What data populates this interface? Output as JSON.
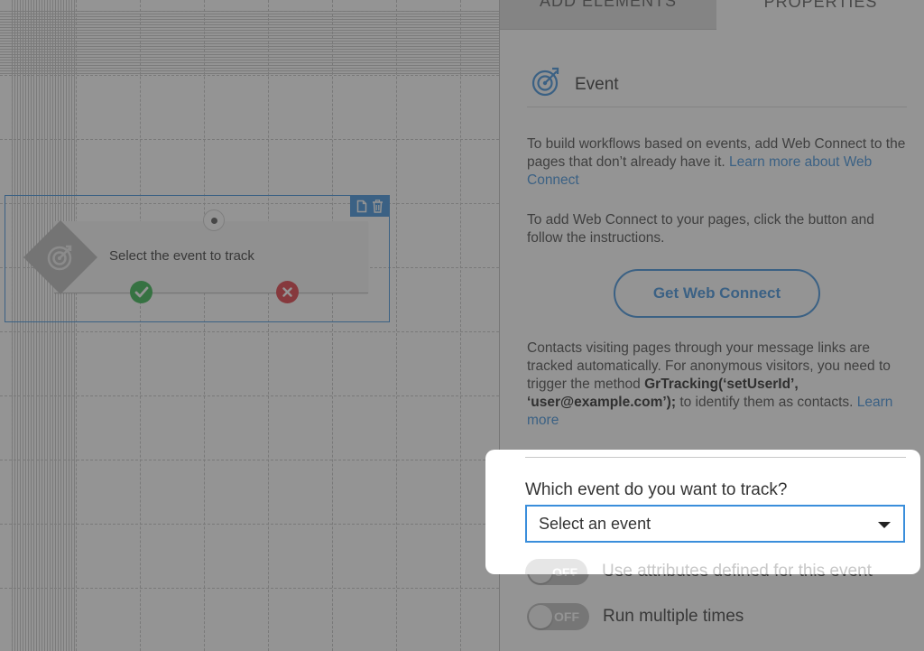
{
  "canvas": {
    "node": {
      "title": "Select the event to track",
      "icons": [
        "target-icon",
        "copy-icon",
        "trash-icon",
        "check-icon",
        "close-icon"
      ]
    }
  },
  "panel": {
    "tabs": [
      {
        "label": "ADD ELEMENTS",
        "active": false
      },
      {
        "label": "PROPERTIES",
        "active": true
      }
    ],
    "header": {
      "title": "Event",
      "icon": "target-icon"
    },
    "intro": {
      "text": "To build workflows based on events, add Web Connect to the pages that don’t already have it.",
      "link": "Learn more about Web Connect"
    },
    "instructions": "To add Web Connect to your pages, click the button and follow the instructions.",
    "webconnect_button": "Get Web Connect",
    "tracking": {
      "text_before": "Contacts visiting pages through your message links are tracked automatically. For anonymous visitors, you need to trigger the method",
      "code": "GrTracking(‘setUserId’, ‘user@example.com’);",
      "text_after": "to identify them as contacts.",
      "link": "Learn more"
    },
    "event_select": {
      "label": "Which event do you want to track?",
      "value": "Select an event"
    },
    "toggles": [
      {
        "label": "Use attributes defined for this event",
        "state": "OFF",
        "enabled": false
      },
      {
        "label": "Run multiple times",
        "state": "OFF",
        "enabled": true
      }
    ]
  },
  "colors": {
    "accent": "#3a8edb",
    "success": "#2fb34a",
    "danger": "#e0353f",
    "overlay": "#3c3c3c"
  }
}
